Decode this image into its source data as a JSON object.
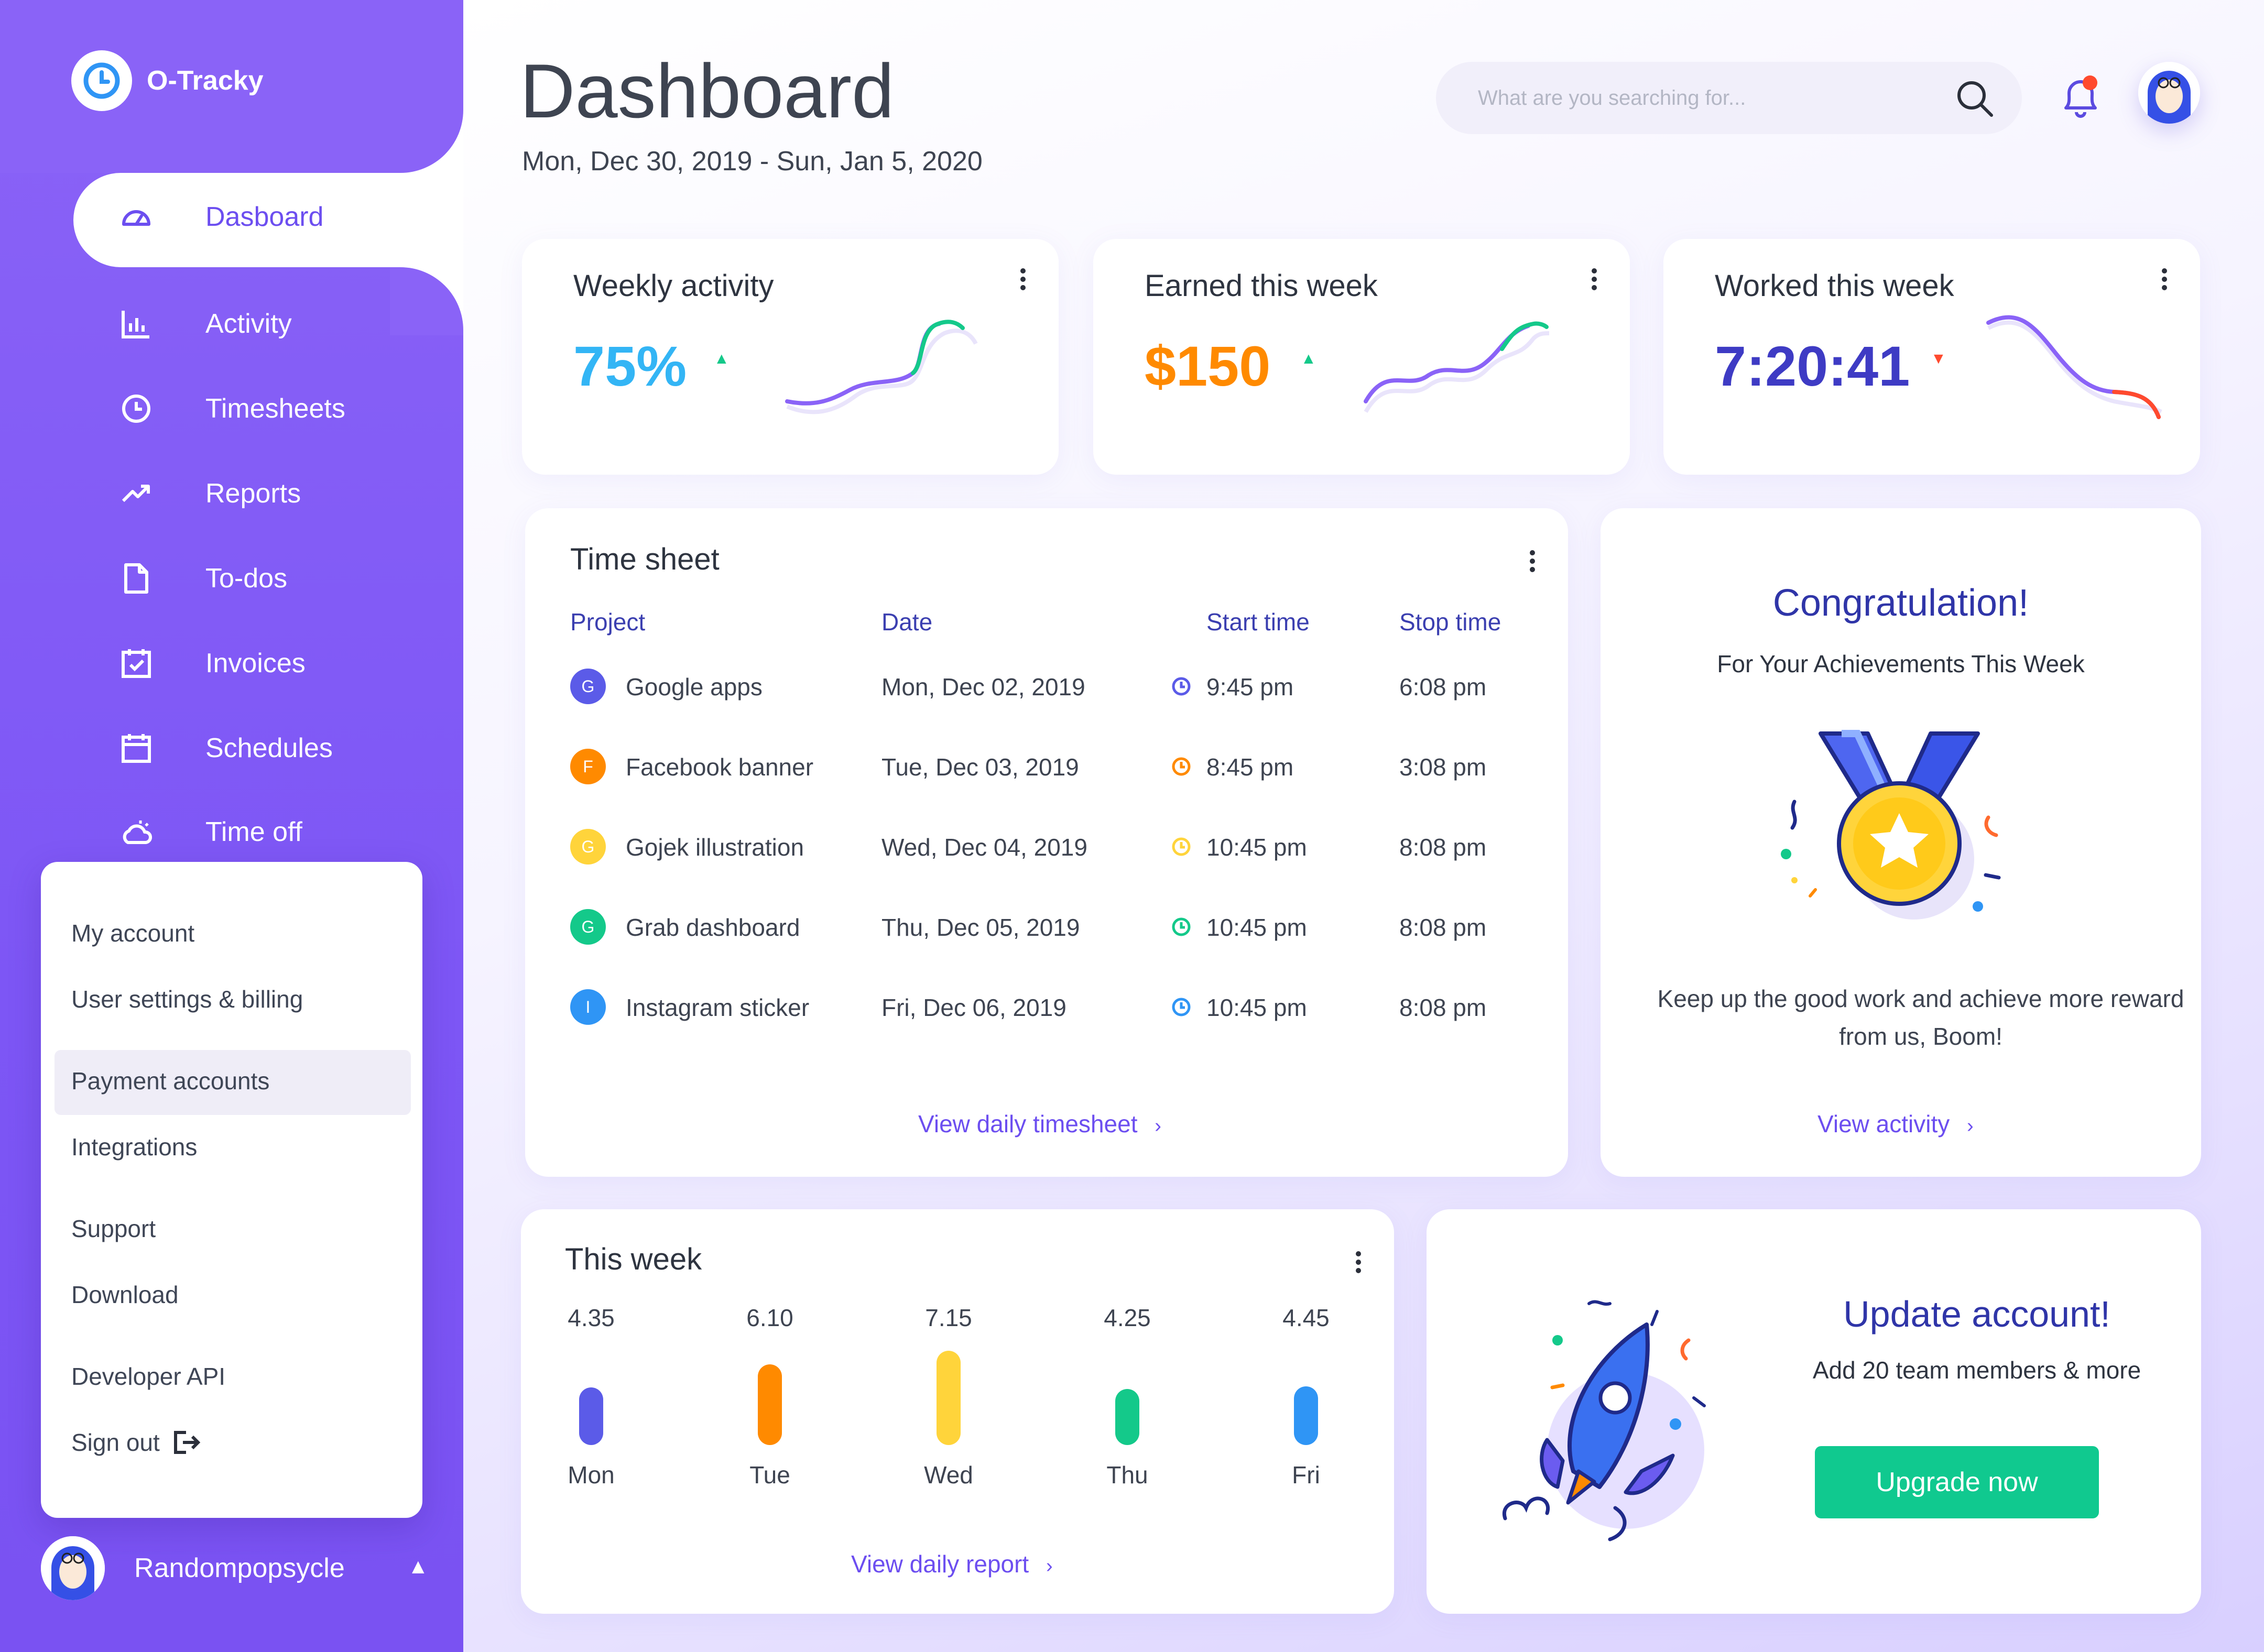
{
  "app": {
    "name": "O-Tracky"
  },
  "sidebar": {
    "items": [
      {
        "label": "Dasboard",
        "icon": "dashboard-gauge-icon",
        "active": true
      },
      {
        "label": "Activity",
        "icon": "bar-chart-icon"
      },
      {
        "label": "Timesheets",
        "icon": "clock-icon"
      },
      {
        "label": "Reports",
        "icon": "trending-up-icon"
      },
      {
        "label": "To-dos",
        "icon": "document-icon"
      },
      {
        "label": "Invoices",
        "icon": "calendar-check-icon"
      },
      {
        "label": "Schedules",
        "icon": "calendar-icon"
      },
      {
        "label": "Time off",
        "icon": "cloud-sun-icon"
      }
    ],
    "menu": {
      "my_account": "My account",
      "user_settings": "User settings & billing",
      "payment_accounts": "Payment accounts",
      "integrations": "Integrations",
      "support": "Support",
      "download": "Download",
      "developer_api": "Developer API",
      "sign_out": "Sign out"
    },
    "user": {
      "name": "Randompopsycle"
    }
  },
  "header": {
    "title": "Dashboard",
    "date_range": "Mon, Dec 30, 2019 - Sun, Jan 5, 2020",
    "search_placeholder": "What are you searching for..."
  },
  "stats": [
    {
      "title": "Weekly activity",
      "value": "75%",
      "trend": "up",
      "color": "#33b5f5"
    },
    {
      "title": "Earned this week",
      "value": "$150",
      "trend": "up",
      "color": "#ff8a00"
    },
    {
      "title": "Worked this week",
      "value": "7:20:41",
      "trend": "down",
      "color": "#3e3bc4"
    }
  ],
  "timesheet": {
    "title": "Time sheet",
    "columns": [
      "Project",
      "Date",
      "Start time",
      "Stop time"
    ],
    "rows": [
      {
        "initial": "G",
        "color": "#5b5be8",
        "project": "Google apps",
        "date": "Mon, Dec 02, 2019",
        "start": "9:45 pm",
        "stop": "6:08 pm"
      },
      {
        "initial": "F",
        "color": "#ff8a00",
        "project": "Facebook banner",
        "date": "Tue, Dec 03, 2019",
        "start": "8:45 pm",
        "stop": "3:08 pm"
      },
      {
        "initial": "G",
        "color": "#ffd43b",
        "project": "Gojek illustration",
        "date": "Wed, Dec 04, 2019",
        "start": "10:45 pm",
        "stop": "8:08 pm"
      },
      {
        "initial": "G",
        "color": "#14c98a",
        "project": "Grab dashboard",
        "date": "Thu, Dec 05, 2019",
        "start": "10:45 pm",
        "stop": "8:08 pm"
      },
      {
        "initial": "I",
        "color": "#2f95f5",
        "project": "Instagram sticker",
        "date": "Fri, Dec 06, 2019",
        "start": "10:45 pm",
        "stop": "8:08 pm"
      }
    ],
    "link": "View daily timesheet"
  },
  "congrats": {
    "title": "Congratulation!",
    "subtitle": "For Your Achievements This Week",
    "body": "Keep up the good work and achieve more reward from us, Boom!",
    "link": "View activity"
  },
  "this_week": {
    "title": "This week",
    "link": "View daily report",
    "days": [
      {
        "day": "Mon",
        "value": "4.35",
        "num": 4.35,
        "color": "#5b5be8"
      },
      {
        "day": "Tue",
        "value": "6.10",
        "num": 6.1,
        "color": "#ff8a00"
      },
      {
        "day": "Wed",
        "value": "7.15",
        "num": 7.15,
        "color": "#ffd43b"
      },
      {
        "day": "Thu",
        "value": "4.25",
        "num": 4.25,
        "color": "#14c98a"
      },
      {
        "day": "Fri",
        "value": "4.45",
        "num": 4.45,
        "color": "#2f95f5"
      }
    ]
  },
  "update": {
    "title": "Update account!",
    "subtitle": "Add 20 team members & more",
    "button": "Upgrade now"
  },
  "colors": {
    "accent": "#7d56f5",
    "link": "#6c4ef0",
    "heading": "#2f35a8",
    "success": "#10c98f"
  }
}
